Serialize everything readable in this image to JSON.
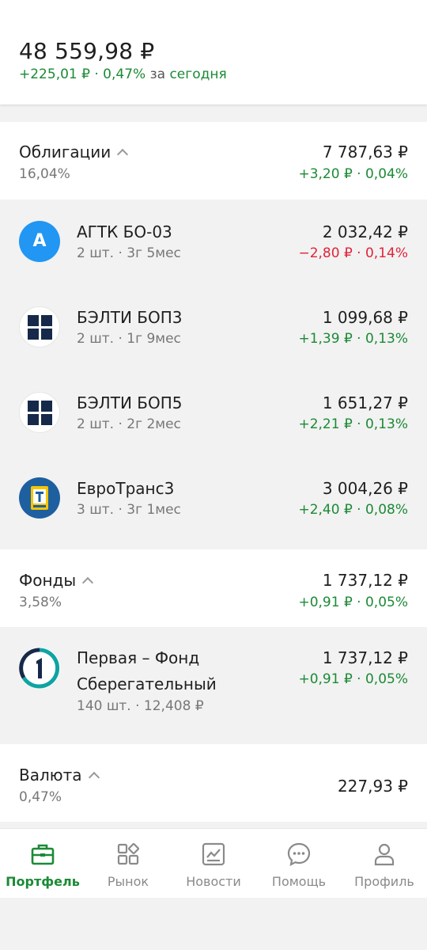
{
  "header": {
    "total": "48 559,98 ₽",
    "change": "+225,01 ₽ · 0,47%",
    "period_word": "за",
    "period": "сегодня"
  },
  "sections": {
    "bonds": {
      "title": "Облигации",
      "percent": "16,04%",
      "value": "7 787,63 ₽",
      "change": "+3,20 ₽ · 0,04%",
      "items": [
        {
          "name": "АГТК БО-03",
          "sub": "2 шт. · 3г 5мес",
          "value": "2 032,42 ₽",
          "change": "−2,80 ₽ · 0,14%",
          "logo_letter": "A",
          "logo_icon": "agtk-logo-icon"
        },
        {
          "name": "БЭЛТИ БОП3",
          "sub": "2 шт. · 1г 9мес",
          "value": "1 099,68 ₽",
          "change": "+1,39 ₽ · 0,13%",
          "logo_icon": "belti-logo-icon"
        },
        {
          "name": "БЭЛТИ БОП5",
          "sub": "2 шт. · 2г 2мес",
          "value": "1 651,27 ₽",
          "change": "+2,21 ₽ · 0,13%",
          "logo_icon": "belti-logo-icon"
        },
        {
          "name": "ЕвроТранс3",
          "sub": "3 шт. · 3г 1мес",
          "value": "3 004,26 ₽",
          "change": "+2,40 ₽ · 0,08%",
          "logo_icon": "evrotrans-logo-icon"
        }
      ]
    },
    "funds": {
      "title": "Фонды",
      "percent": "3,58%",
      "value": "1 737,12 ₽",
      "change": "+0,91 ₽ · 0,05%",
      "items": [
        {
          "name_line1": "Первая – Фонд",
          "name_line2": "Сберегательный",
          "sub": "140 шт. · 12,408 ₽",
          "value": "1 737,12 ₽",
          "change": "+0,91 ₽ · 0,05%",
          "logo_icon": "pervaya-logo-icon"
        }
      ]
    },
    "currency": {
      "title": "Валюта",
      "percent": "0,47%",
      "value": "227,93 ₽"
    }
  },
  "tabbar": {
    "tabs": [
      {
        "label": "Портфель",
        "icon": "briefcase-icon",
        "active": true
      },
      {
        "label": "Рынок",
        "icon": "market-grid-icon"
      },
      {
        "label": "Новости",
        "icon": "news-chart-icon"
      },
      {
        "label": "Помощь",
        "icon": "chat-bubble-icon"
      },
      {
        "label": "Профиль",
        "icon": "person-icon"
      }
    ]
  },
  "colors": {
    "green": "#1b8a35",
    "red": "#e0233a",
    "agtk_blue": "#2196f3",
    "belti_navy": "#16294a",
    "evrotrans_blue": "#1e5fa0",
    "pervaya_teal": "#0fa3a3"
  }
}
